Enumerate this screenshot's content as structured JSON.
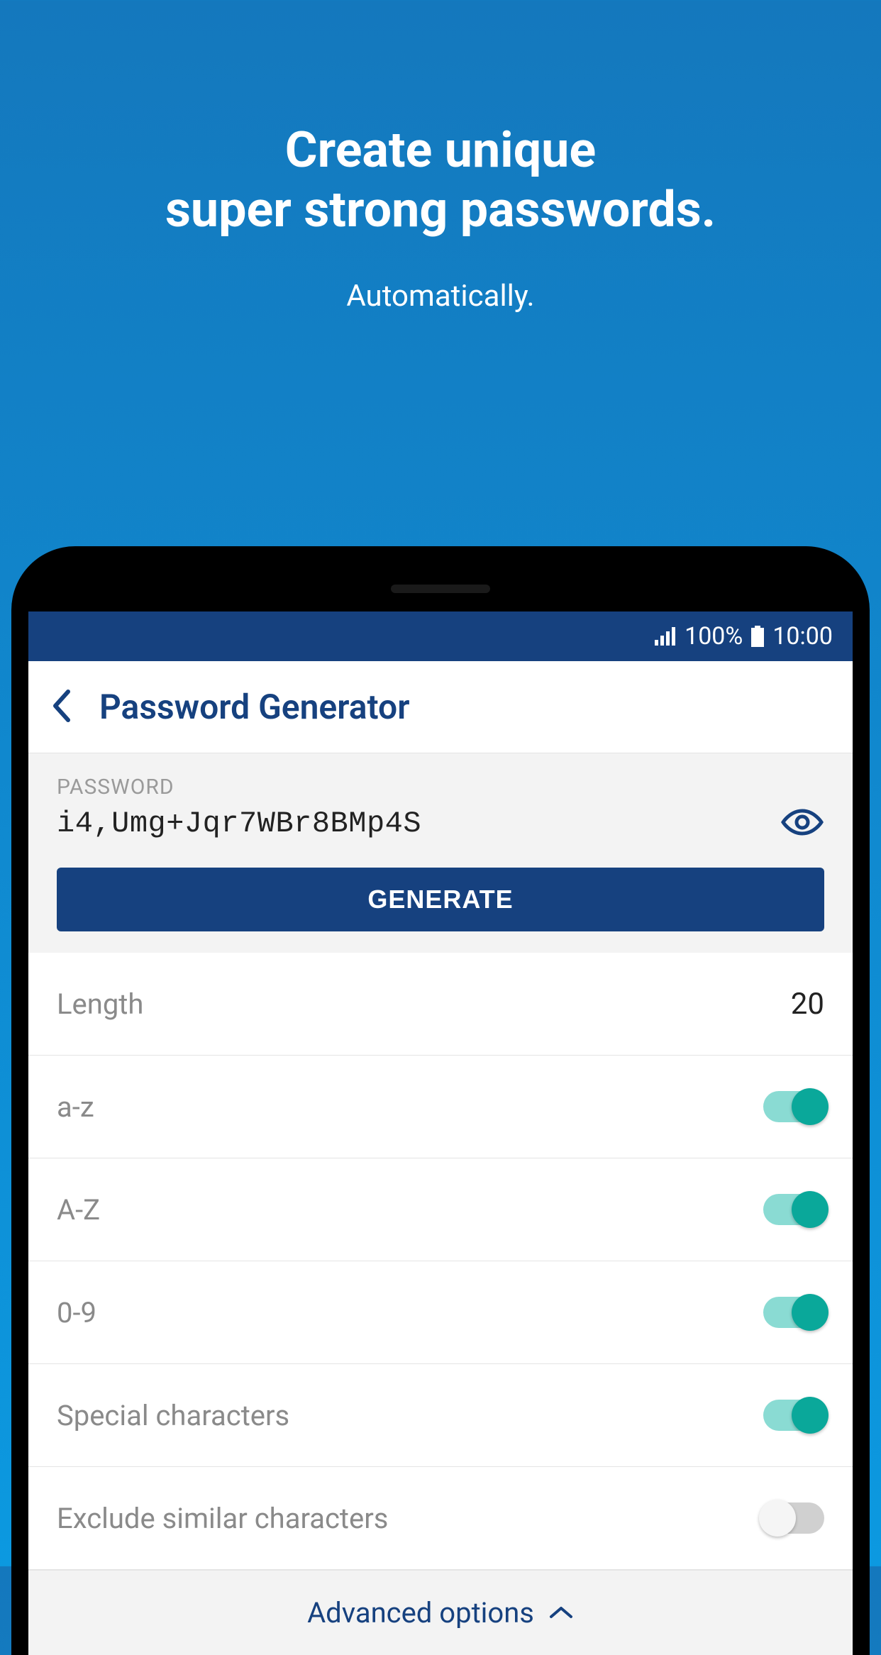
{
  "promo": {
    "title_line1": "Create unique",
    "title_line2": "super strong passwords.",
    "subtitle": "Automatically."
  },
  "statusbar": {
    "battery_pct": "100%",
    "time": "10:00"
  },
  "header": {
    "title": "Password Generator"
  },
  "password": {
    "label": "PASSWORD",
    "value": "i4,Umg+Jqr7WBr8BMp4S",
    "generate_label": "GENERATE"
  },
  "options": {
    "length_label": "Length",
    "length_value": "20",
    "rows": [
      {
        "label": "a-z",
        "on": true
      },
      {
        "label": "A-Z",
        "on": true
      },
      {
        "label": "0-9",
        "on": true
      },
      {
        "label": "Special characters",
        "on": true
      },
      {
        "label": "Exclude similar characters",
        "on": false
      }
    ]
  },
  "advanced_label": "Advanced options"
}
